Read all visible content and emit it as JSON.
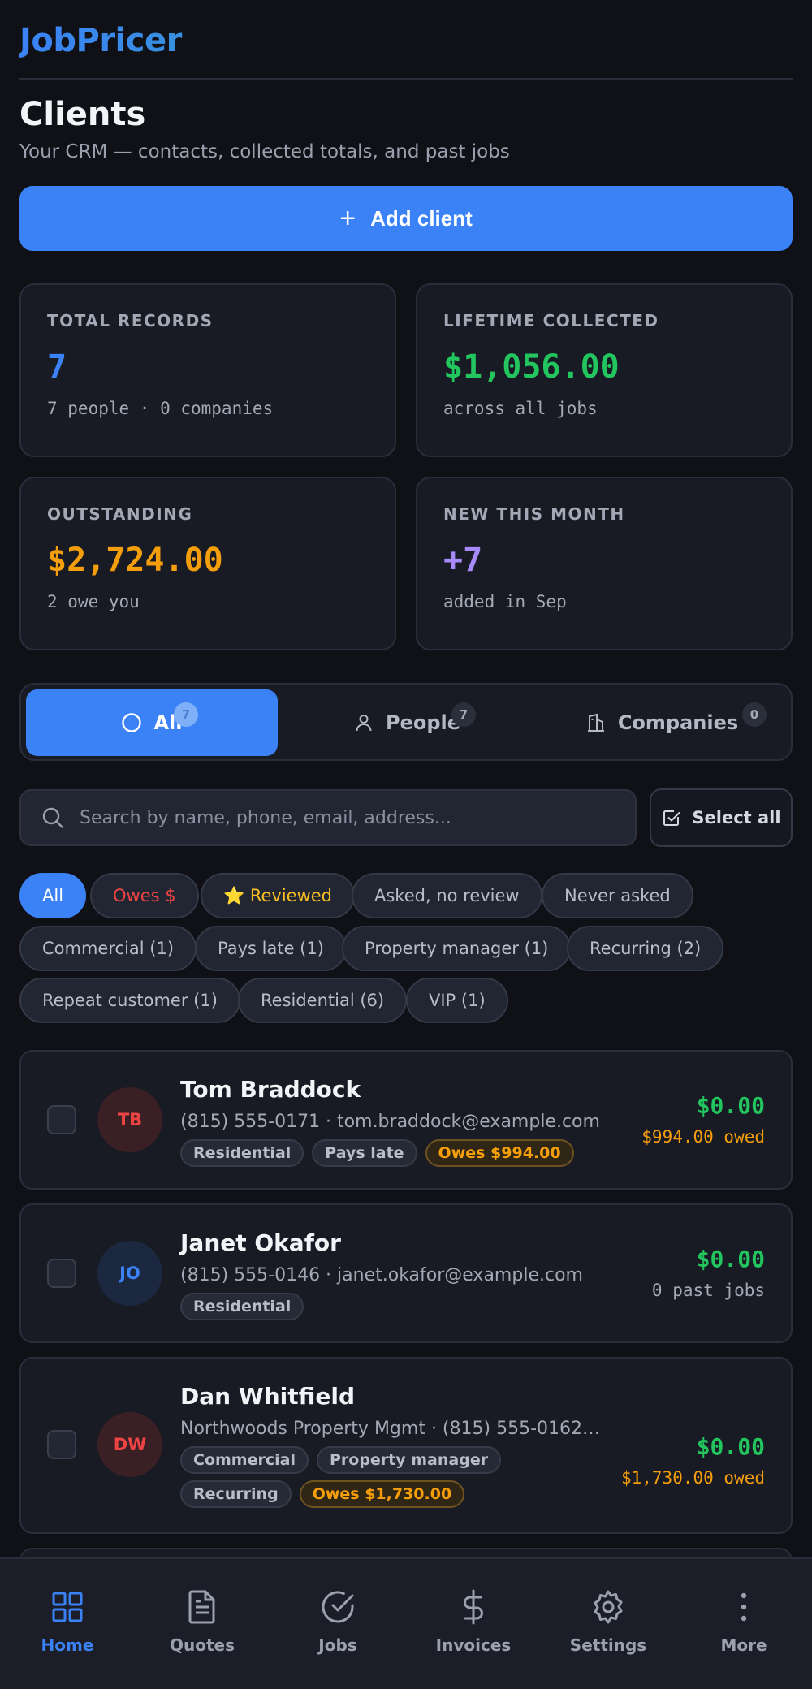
{
  "app": {
    "brand": "JobPricer"
  },
  "page": {
    "title": "Clients",
    "subtitle": "Your CRM — contacts, collected totals, and past jobs",
    "add_button": "Add client"
  },
  "stats": [
    {
      "label": "TOTAL RECORDS",
      "value": "7",
      "sub": "7 people · 0 companies",
      "color": "#3b82f6"
    },
    {
      "label": "LIFETIME COLLECTED",
      "value": "$1,056.00",
      "sub": "across all jobs",
      "color": "#22c55e"
    },
    {
      "label": "OUTSTANDING",
      "value": "$2,724.00",
      "sub": "2 owe you",
      "color": "#f59e0b"
    },
    {
      "label": "NEW THIS MONTH",
      "value": "+7",
      "sub": "added in Sep",
      "color": "#a78bfa"
    }
  ],
  "tabs": [
    {
      "label": "All",
      "count": "7",
      "icon": "circle-icon",
      "active": true
    },
    {
      "label": "People",
      "count": "7",
      "icon": "person-icon",
      "active": false
    },
    {
      "label": "Companies",
      "count": "0",
      "icon": "building-icon",
      "active": false
    }
  ],
  "search": {
    "placeholder": "Search by name, phone, email, address...",
    "value": "",
    "select_all": "Select all"
  },
  "filters": [
    {
      "label": "All",
      "active": true
    },
    {
      "label": "Owes $",
      "style": "red"
    },
    {
      "label": "⭐ Reviewed",
      "style": "gold"
    },
    {
      "label": "Asked, no review"
    },
    {
      "label": "Never asked"
    },
    {
      "label": "Commercial (1)"
    },
    {
      "label": "Pays late (1)"
    },
    {
      "label": "Property manager (1)"
    },
    {
      "label": "Recurring (2)"
    },
    {
      "label": "Repeat customer (1)"
    },
    {
      "label": "Residential (6)"
    },
    {
      "label": "VIP (1)"
    }
  ],
  "clients": [
    {
      "initials": "TB",
      "name": "Tom Braddock",
      "contact": "(815) 555-0171 · tom.braddock@example.com",
      "tags": [
        "Residential",
        "Pays late"
      ],
      "owes_tag": "Owes $994.00",
      "collected": "$0.00",
      "status": "$994.00 owed",
      "avatar_color": "#ef4444"
    },
    {
      "initials": "JO",
      "name": "Janet Okafor",
      "contact": "(815) 555-0146 · janet.okafor@example.com",
      "tags": [
        "Residential"
      ],
      "collected": "$0.00",
      "status": "0 past jobs",
      "avatar_color": "#3b82f6"
    },
    {
      "initials": "DW",
      "name": "Dan Whitfield",
      "contact": "Northwoods Property Mgmt · (815) 555-0162 · da...",
      "tags": [
        "Commercial",
        "Property manager",
        "Recurring"
      ],
      "owes_tag": "Owes $1,730.00",
      "collected": "$0.00",
      "status": "$1,730.00 owed",
      "avatar_color": "#ef4444"
    }
  ],
  "nav": [
    {
      "label": "Home",
      "icon": "grid-icon",
      "active": true
    },
    {
      "label": "Quotes",
      "icon": "document-icon"
    },
    {
      "label": "Jobs",
      "icon": "check-circle-icon"
    },
    {
      "label": "Invoices",
      "icon": "dollar-icon"
    },
    {
      "label": "Settings",
      "icon": "gear-icon"
    },
    {
      "label": "More",
      "icon": "more-vertical-icon"
    }
  ]
}
